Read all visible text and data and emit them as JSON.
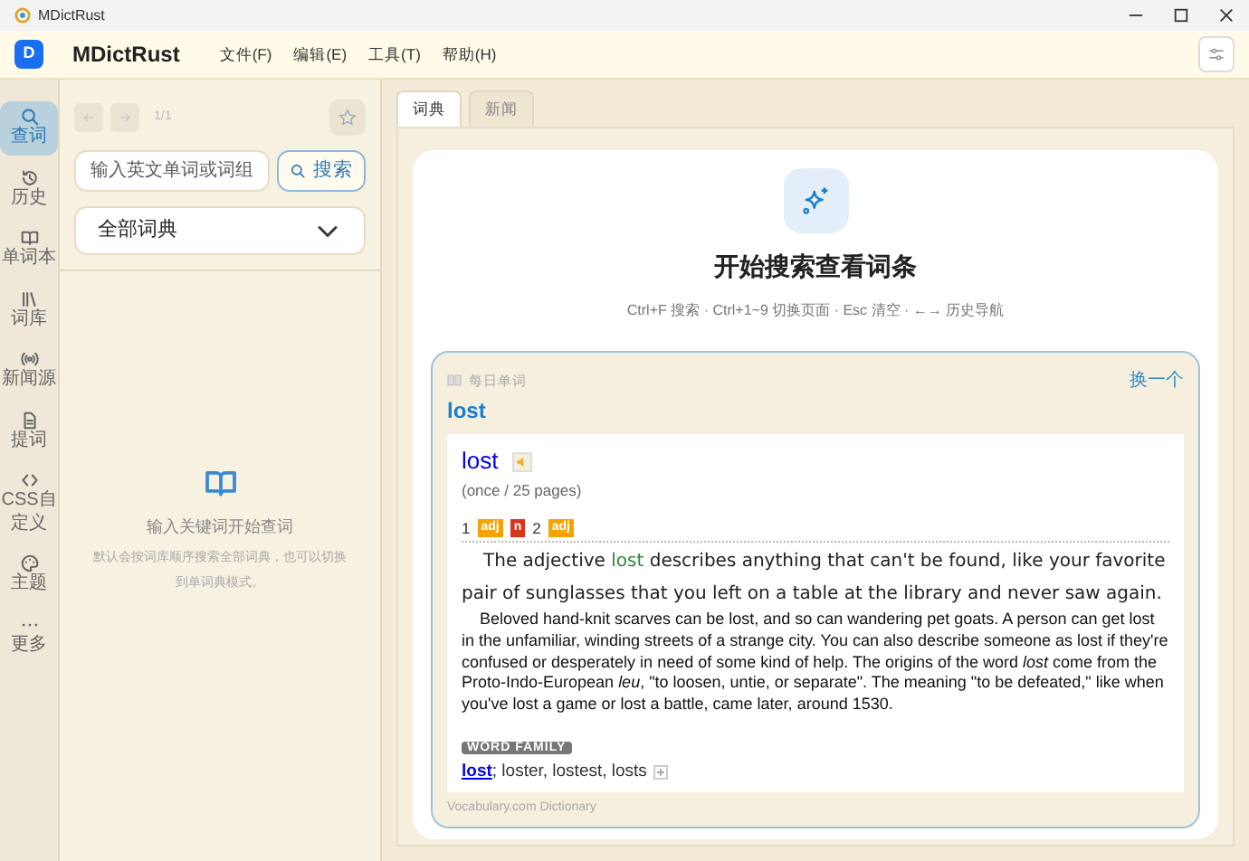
{
  "window": {
    "title": "MDictRust"
  },
  "header": {
    "logo": "D",
    "app_name": "MDictRust",
    "menus": [
      "文件(F)",
      "编辑(E)",
      "工具(T)",
      "帮助(H)"
    ]
  },
  "rail": [
    {
      "label": "查词",
      "selected": true
    },
    {
      "label": "历史",
      "selected": false
    },
    {
      "label": "单词本",
      "selected": false
    },
    {
      "label": "词库",
      "selected": false
    },
    {
      "label": "新闻源",
      "selected": false
    },
    {
      "label": "提词",
      "selected": false
    },
    {
      "label": "CSS自定义",
      "selected": false
    },
    {
      "label": "主题",
      "selected": false
    },
    {
      "label": "更多",
      "selected": false
    }
  ],
  "search_panel": {
    "page": "1/1",
    "input": {
      "placeholder": "输入英文单词或词组"
    },
    "search_button": "搜索",
    "dictionary": "全部词典",
    "empty_title": "输入关键词开始查词",
    "empty_text": "默认会按词库顺序搜索全部词典，也可以切换到单词典模式。"
  },
  "tabs": [
    {
      "label": "词典",
      "selected": true
    },
    {
      "label": "新闻",
      "selected": false
    }
  ],
  "start": {
    "title": "开始搜索查看词条",
    "shortcuts": "Ctrl+F 搜索 · Ctrl+1~9 切换页面 · Esc 清空 · ←→ 历史导航"
  },
  "daily": {
    "label": "每日单词",
    "refresh": "换一个",
    "word": "lost",
    "entry": {
      "headword": "lost",
      "frequency": "(once / 25 pages)",
      "senses": [
        {
          "number": "1",
          "tags": [
            {
              "label": "adj",
              "color": "#f5a300"
            },
            {
              "label": "n",
              "color": "#d9331a"
            }
          ]
        },
        {
          "number": "2",
          "tags": [
            {
              "label": "adj",
              "color": "#f5a300"
            }
          ]
        }
      ],
      "short_definition": [
        {
          "kind": "plain",
          "text": "The adjective "
        },
        {
          "kind": "highlight",
          "text": "lost"
        },
        {
          "kind": "plain",
          "text": " describes anything that can't be found, like your favorite pair of sunglasses that you left on a table at the library and never saw again."
        }
      ],
      "long_definition": "Beloved hand-knit scarves can be lost, and so can wandering pet goats. A person can get lost in the unfamiliar, winding streets of a strange city. You can also describe someone as lost if they're confused or desperately in need of some kind of help. The origins of the word *lost* come from the Proto-Indo-European *leu*, \"to loosen, untie, or separate\". The meaning \"to be defeated,\" like when you've lost a game or lost a battle, came later, around 1530.",
      "family_label": "WORD FAMILY",
      "family_link": "lost",
      "family_rest": "; loster, lostest, losts"
    },
    "source": "Vocabulary.com Dictionary"
  }
}
